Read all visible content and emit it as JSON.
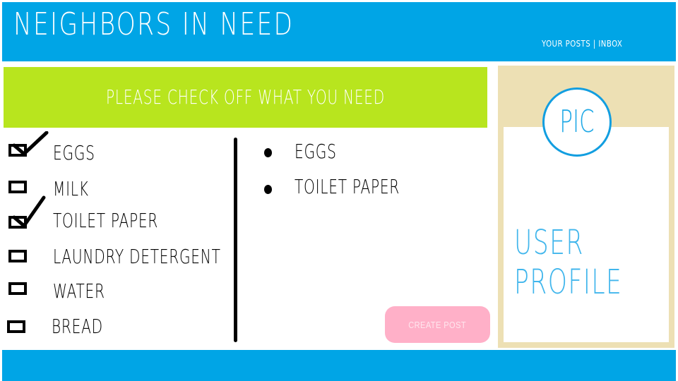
{
  "header": {
    "title": "NEIGHBORS IN NEED",
    "nav": {
      "your_posts": "YOUR POSTS",
      "separator": "|",
      "inbox": "INBOX"
    }
  },
  "banner": {
    "text": "PLEASE CHECK OFF WHAT YOU NEED"
  },
  "checklist": [
    {
      "label": "EGGS",
      "checked": true
    },
    {
      "label": "MILK",
      "checked": false
    },
    {
      "label": "TOILET PAPER",
      "checked": true
    },
    {
      "label": "LAUNDRY DETERGENT",
      "checked": false
    },
    {
      "label": "WATER",
      "checked": false
    },
    {
      "label": "BREAD",
      "checked": false
    }
  ],
  "selected_list": [
    "EGGS",
    "TOILET PAPER"
  ],
  "create_post_label": "CREATE POST",
  "profile": {
    "pic_text": "PIC",
    "label_line1": "USER",
    "label_line2": "PROFILE"
  },
  "colors": {
    "header": "#00a5e6",
    "banner": "#b8e51e",
    "button": "#ffb0c8",
    "profile_bg": "#ede0b4",
    "accent": "#129ee0"
  }
}
